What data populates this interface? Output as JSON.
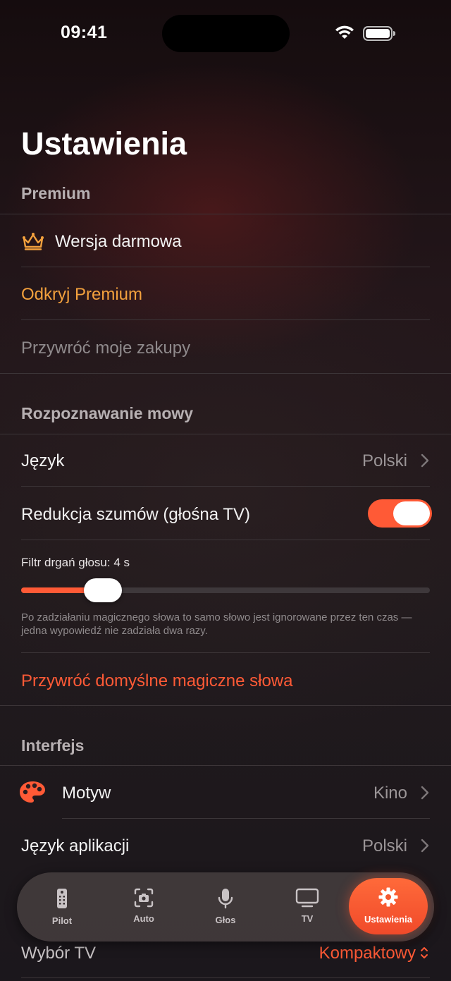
{
  "status_bar": {
    "time": "09:41"
  },
  "page_title": "Ustawienia",
  "premium": {
    "header": "Premium",
    "free_version": "Wersja darmowa",
    "discover": "Odkryj Premium",
    "restore": "Przywróć moje zakupy"
  },
  "speech": {
    "header": "Rozpoznawanie mowy",
    "language_label": "Język",
    "language_value": "Polski",
    "noise_label": "Redukcja szumów (głośna TV)",
    "noise_enabled": true,
    "filter_label": "Filtr drgań głosu: 4 s",
    "filter_fraction": 0.2,
    "footnote": "Po zadziałaniu magicznego słowa to samo słowo jest ignorowane przez ten czas — jedna wypowiedź nie zadziała dwa razy.",
    "restore_magic": "Przywróć domyślne magiczne słowa"
  },
  "interface": {
    "header": "Interfejs",
    "theme_label": "Motyw",
    "theme_value": "Kino",
    "app_lang_label": "Język aplikacji",
    "app_lang_value": "Polski",
    "tv_choice_label": "Wybór TV",
    "tv_choice_value": "Kompaktowy"
  },
  "tabbar": {
    "tabs": [
      {
        "label": "Pilot",
        "icon": "remote-icon"
      },
      {
        "label": "Auto",
        "icon": "camera-scan-icon"
      },
      {
        "label": "Głos",
        "icon": "microphone-icon"
      },
      {
        "label": "TV",
        "icon": "tv-icon"
      },
      {
        "label": "Ustawienia",
        "icon": "gear-icon"
      }
    ],
    "active_index": 4
  },
  "colors": {
    "accent": "#ff5a36",
    "premium_orange": "#f3a13d"
  }
}
